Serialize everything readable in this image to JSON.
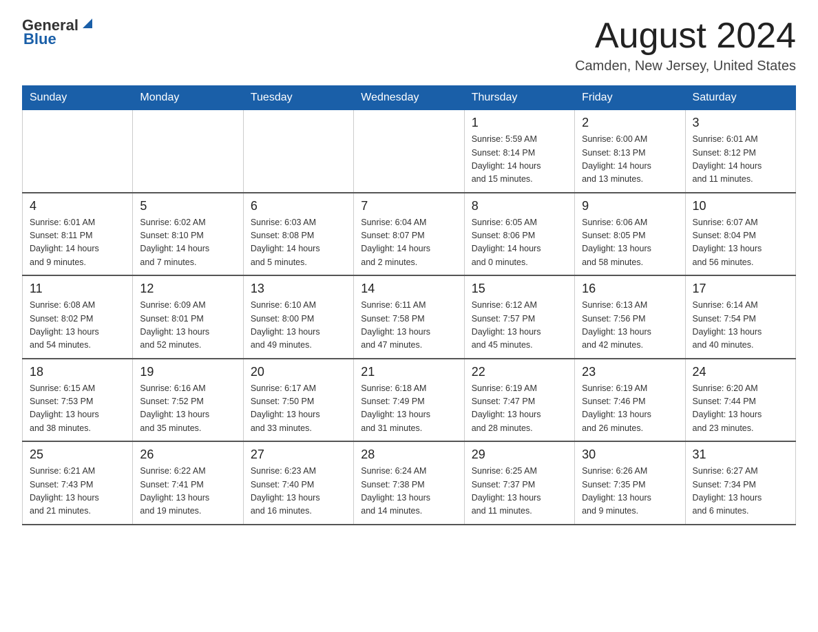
{
  "header": {
    "logo_general": "General",
    "logo_blue": "Blue",
    "title": "August 2024",
    "subtitle": "Camden, New Jersey, United States"
  },
  "weekdays": [
    "Sunday",
    "Monday",
    "Tuesday",
    "Wednesday",
    "Thursday",
    "Friday",
    "Saturday"
  ],
  "weeks": [
    [
      {
        "day": "",
        "info": ""
      },
      {
        "day": "",
        "info": ""
      },
      {
        "day": "",
        "info": ""
      },
      {
        "day": "",
        "info": ""
      },
      {
        "day": "1",
        "info": "Sunrise: 5:59 AM\nSunset: 8:14 PM\nDaylight: 14 hours\nand 15 minutes."
      },
      {
        "day": "2",
        "info": "Sunrise: 6:00 AM\nSunset: 8:13 PM\nDaylight: 14 hours\nand 13 minutes."
      },
      {
        "day": "3",
        "info": "Sunrise: 6:01 AM\nSunset: 8:12 PM\nDaylight: 14 hours\nand 11 minutes."
      }
    ],
    [
      {
        "day": "4",
        "info": "Sunrise: 6:01 AM\nSunset: 8:11 PM\nDaylight: 14 hours\nand 9 minutes."
      },
      {
        "day": "5",
        "info": "Sunrise: 6:02 AM\nSunset: 8:10 PM\nDaylight: 14 hours\nand 7 minutes."
      },
      {
        "day": "6",
        "info": "Sunrise: 6:03 AM\nSunset: 8:08 PM\nDaylight: 14 hours\nand 5 minutes."
      },
      {
        "day": "7",
        "info": "Sunrise: 6:04 AM\nSunset: 8:07 PM\nDaylight: 14 hours\nand 2 minutes."
      },
      {
        "day": "8",
        "info": "Sunrise: 6:05 AM\nSunset: 8:06 PM\nDaylight: 14 hours\nand 0 minutes."
      },
      {
        "day": "9",
        "info": "Sunrise: 6:06 AM\nSunset: 8:05 PM\nDaylight: 13 hours\nand 58 minutes."
      },
      {
        "day": "10",
        "info": "Sunrise: 6:07 AM\nSunset: 8:04 PM\nDaylight: 13 hours\nand 56 minutes."
      }
    ],
    [
      {
        "day": "11",
        "info": "Sunrise: 6:08 AM\nSunset: 8:02 PM\nDaylight: 13 hours\nand 54 minutes."
      },
      {
        "day": "12",
        "info": "Sunrise: 6:09 AM\nSunset: 8:01 PM\nDaylight: 13 hours\nand 52 minutes."
      },
      {
        "day": "13",
        "info": "Sunrise: 6:10 AM\nSunset: 8:00 PM\nDaylight: 13 hours\nand 49 minutes."
      },
      {
        "day": "14",
        "info": "Sunrise: 6:11 AM\nSunset: 7:58 PM\nDaylight: 13 hours\nand 47 minutes."
      },
      {
        "day": "15",
        "info": "Sunrise: 6:12 AM\nSunset: 7:57 PM\nDaylight: 13 hours\nand 45 minutes."
      },
      {
        "day": "16",
        "info": "Sunrise: 6:13 AM\nSunset: 7:56 PM\nDaylight: 13 hours\nand 42 minutes."
      },
      {
        "day": "17",
        "info": "Sunrise: 6:14 AM\nSunset: 7:54 PM\nDaylight: 13 hours\nand 40 minutes."
      }
    ],
    [
      {
        "day": "18",
        "info": "Sunrise: 6:15 AM\nSunset: 7:53 PM\nDaylight: 13 hours\nand 38 minutes."
      },
      {
        "day": "19",
        "info": "Sunrise: 6:16 AM\nSunset: 7:52 PM\nDaylight: 13 hours\nand 35 minutes."
      },
      {
        "day": "20",
        "info": "Sunrise: 6:17 AM\nSunset: 7:50 PM\nDaylight: 13 hours\nand 33 minutes."
      },
      {
        "day": "21",
        "info": "Sunrise: 6:18 AM\nSunset: 7:49 PM\nDaylight: 13 hours\nand 31 minutes."
      },
      {
        "day": "22",
        "info": "Sunrise: 6:19 AM\nSunset: 7:47 PM\nDaylight: 13 hours\nand 28 minutes."
      },
      {
        "day": "23",
        "info": "Sunrise: 6:19 AM\nSunset: 7:46 PM\nDaylight: 13 hours\nand 26 minutes."
      },
      {
        "day": "24",
        "info": "Sunrise: 6:20 AM\nSunset: 7:44 PM\nDaylight: 13 hours\nand 23 minutes."
      }
    ],
    [
      {
        "day": "25",
        "info": "Sunrise: 6:21 AM\nSunset: 7:43 PM\nDaylight: 13 hours\nand 21 minutes."
      },
      {
        "day": "26",
        "info": "Sunrise: 6:22 AM\nSunset: 7:41 PM\nDaylight: 13 hours\nand 19 minutes."
      },
      {
        "day": "27",
        "info": "Sunrise: 6:23 AM\nSunset: 7:40 PM\nDaylight: 13 hours\nand 16 minutes."
      },
      {
        "day": "28",
        "info": "Sunrise: 6:24 AM\nSunset: 7:38 PM\nDaylight: 13 hours\nand 14 minutes."
      },
      {
        "day": "29",
        "info": "Sunrise: 6:25 AM\nSunset: 7:37 PM\nDaylight: 13 hours\nand 11 minutes."
      },
      {
        "day": "30",
        "info": "Sunrise: 6:26 AM\nSunset: 7:35 PM\nDaylight: 13 hours\nand 9 minutes."
      },
      {
        "day": "31",
        "info": "Sunrise: 6:27 AM\nSunset: 7:34 PM\nDaylight: 13 hours\nand 6 minutes."
      }
    ]
  ]
}
